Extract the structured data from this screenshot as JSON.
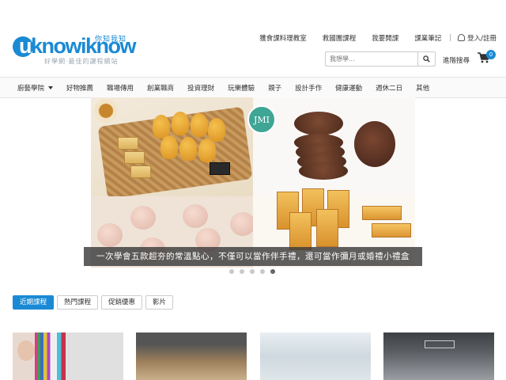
{
  "brand": {
    "logo_text": "uknowiknow",
    "logo_cn": "你知我知",
    "tagline": "好學網‧最佳的課程網站"
  },
  "top_links": [
    "獲食課料理教室",
    "救國團課程",
    "我要開課",
    "課業筆記"
  ],
  "account_label": "登入/註冊",
  "search": {
    "placeholder": "我想學..."
  },
  "advanced_search_label": "進階搜尋",
  "cart_count": "0",
  "nav": [
    "廚藝學院",
    "好物推薦",
    "職場傳用",
    "創業職商",
    "投資理財",
    "玩樂體驗",
    "親子",
    "設計手作",
    "健康運動",
    "週休二日",
    "其他"
  ],
  "carousel": {
    "badge": "JMI",
    "caption": "一次學會五款超夯的常溫點心，不僅可以當作伴手禮，還可當作彌月或婚禮小禮盒",
    "slide_count": 5,
    "active_slide": 5
  },
  "tabs": [
    "近期課程",
    "熱門課程",
    "促銷優惠",
    "影片"
  ],
  "active_tab": 0,
  "colors": {
    "accent": "#1a8ad4",
    "caption_bg": "#3c3c3c"
  }
}
